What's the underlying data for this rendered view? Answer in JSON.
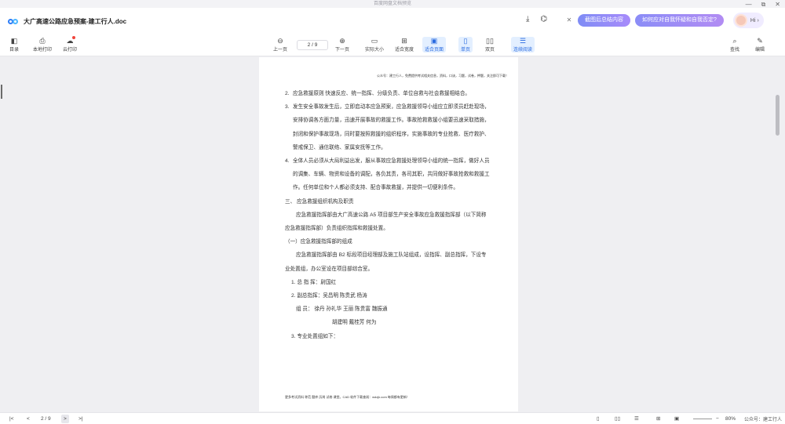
{
  "window": {
    "title": "百度网盘文档预览",
    "controls": [
      "—",
      "⧉",
      "✕"
    ]
  },
  "header": {
    "filename": "大广高速公路应急预案-建工行人.doc",
    "icons": [
      "download-icon",
      "share-icon"
    ],
    "ai": {
      "close": "✕",
      "pill1": "截图后总结内容",
      "pill2": "如何应对自我怀疑和自我否定?",
      "greeting": "Hi ›"
    }
  },
  "toolbar": {
    "left": [
      {
        "label": "目录",
        "icon": "catalog-icon"
      },
      {
        "label": "本地打印",
        "icon": "print-icon"
      },
      {
        "label": "云打印",
        "icon": "cloud-print-icon"
      }
    ],
    "prev_label": "上一页",
    "page_value": "2 / 9",
    "next_label": "下一页",
    "view_modes": [
      {
        "label": "实际大小",
        "icon": "actual-size-icon"
      },
      {
        "label": "适合宽度",
        "icon": "fit-width-icon"
      },
      {
        "label": "适合页面",
        "icon": "fit-page-icon",
        "active": true
      },
      {
        "label": "单页",
        "icon": "single-page-icon",
        "active": true
      },
      {
        "label": "双页",
        "icon": "double-page-icon"
      },
      {
        "label": "连续阅读",
        "icon": "continuous-read-icon",
        "active": true
      }
    ],
    "right": [
      {
        "label": "查找",
        "icon": "search-icon"
      },
      {
        "label": "编辑",
        "icon": "edit-icon"
      }
    ]
  },
  "document": {
    "page_header": "公众号：建工行人，免费提供考试相关信息，资料，口诀，习题，试卷，押题，关注即可下载！",
    "paragraphs": [
      {
        "num": "2.",
        "text": "应急救援原则 快速反应、统一指挥、分级负责、单位自救与社会救援相结合。"
      },
      {
        "num": "3.",
        "text": "发生安全事故发生后，立即启动本应急预案，应急救援领导小组应立即须员赶赴现场，安排协调各方面力量，迅速开展事故的救援工作。事故抢救救援小组要迅速采取措施，封闭和保护事故现场，同时要按照救援的组织程序，实施事故的专业抢救、医疗救护、警戒保卫、通信联络、家属安抚等工作。"
      },
      {
        "num": "4.",
        "text": "全体人员必须从大局利益出发，服从事故应急救援处理领导小组的统一指挥，做好人员的调集、车辆、物资和设备的调配，各负其责，各司其职，共同做好事故抢救和救援工作。任何单位和个人都必须支持、配合事故救援，并提供一切便利条件。"
      }
    ],
    "section_title": "三、  应急救援组织机构及职责",
    "section_text": "应急救援指挥部由大广高速公路 A5 项目部生产安全事故应急救援指挥部（以下简称应急救援指挥部）负责组织指挥和救援处置。",
    "sub_title": "（一）应急救援指挥部的组成",
    "sub_text": "应急救援指挥部由 B2 标段项目经理部及施工队站组成，设指挥、副总指挥，下设专业处置组，办公室设在项目部综合室。",
    "members": [
      "1. 总 指 挥：尉国红",
      "2. 副总指挥：吴昌明   陈贵武   杨涛",
      "组     员：  徐丹     孙礼华  王丽  陈贵富  魏振通",
      "胡建明   戴桂芳   何为",
      "3. 专业处置组如下："
    ],
    "page_footer": "更多考试资料 称范 题库 历岗 试卷 课堂。CAD 软件下载查阅：wdzjk.com 每周都有更新！"
  },
  "statusbar": {
    "page_value": "2 / 9",
    "zoom": "80%",
    "watermark": "公众号：建工行人"
  }
}
